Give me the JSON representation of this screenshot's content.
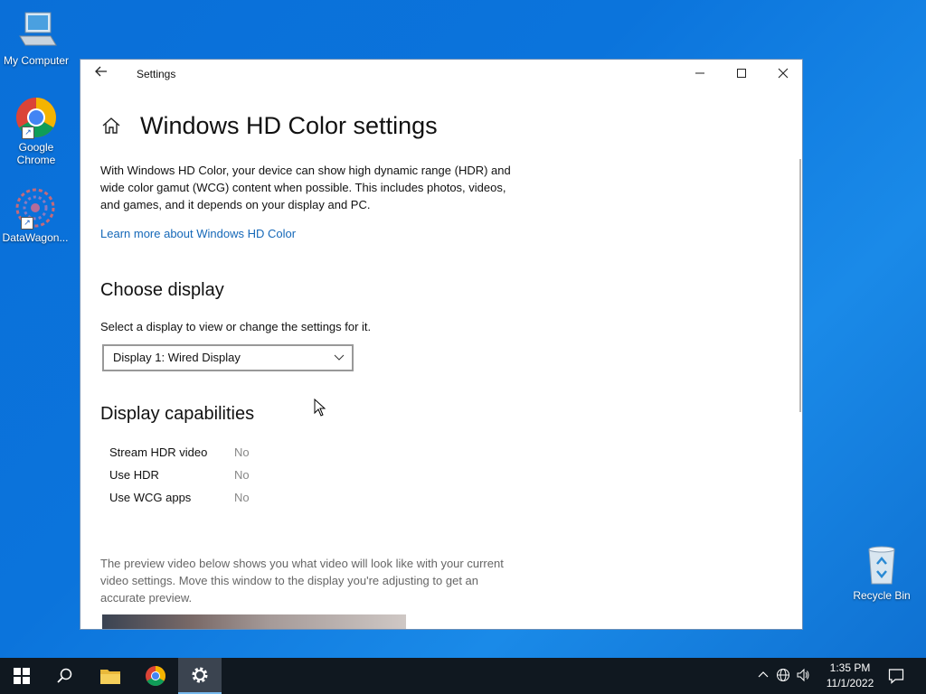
{
  "desktop": {
    "icons": [
      {
        "label": "My Computer"
      },
      {
        "label": "Google Chrome"
      },
      {
        "label": "DataWagon..."
      },
      {
        "label": "Recycle Bin"
      }
    ]
  },
  "window": {
    "title": "Settings",
    "controls": {
      "minimize": "─",
      "maximize": "☐",
      "close": "✕"
    }
  },
  "page": {
    "title": "Windows HD Color settings",
    "description": "With Windows HD Color, your device can show high dynamic range (HDR) and wide color gamut (WCG) content when possible. This includes photos, videos, and games, and it depends on your display and PC.",
    "learn_more_link": "Learn more about Windows HD Color",
    "choose_display": {
      "heading": "Choose display",
      "instruction": "Select a display to view or change the settings for it.",
      "selected_display": "Display 1: Wired Display"
    },
    "capabilities": {
      "heading": "Display capabilities",
      "rows": [
        {
          "label": "Stream HDR video",
          "value": "No"
        },
        {
          "label": "Use HDR",
          "value": "No"
        },
        {
          "label": "Use WCG apps",
          "value": "No"
        }
      ]
    },
    "preview_text": "The preview video below shows you what video will look like with your current video settings. Move this window to the display you're adjusting to get an accurate preview."
  },
  "taskbar": {
    "time": "1:35 PM",
    "date": "11/1/2022",
    "pinned": [
      "start",
      "search",
      "file-explorer",
      "google-chrome",
      "settings"
    ],
    "active": "settings"
  },
  "colors": {
    "accent": "#1568b8",
    "taskbar": "#101820",
    "desktop": "#0b74dc"
  }
}
